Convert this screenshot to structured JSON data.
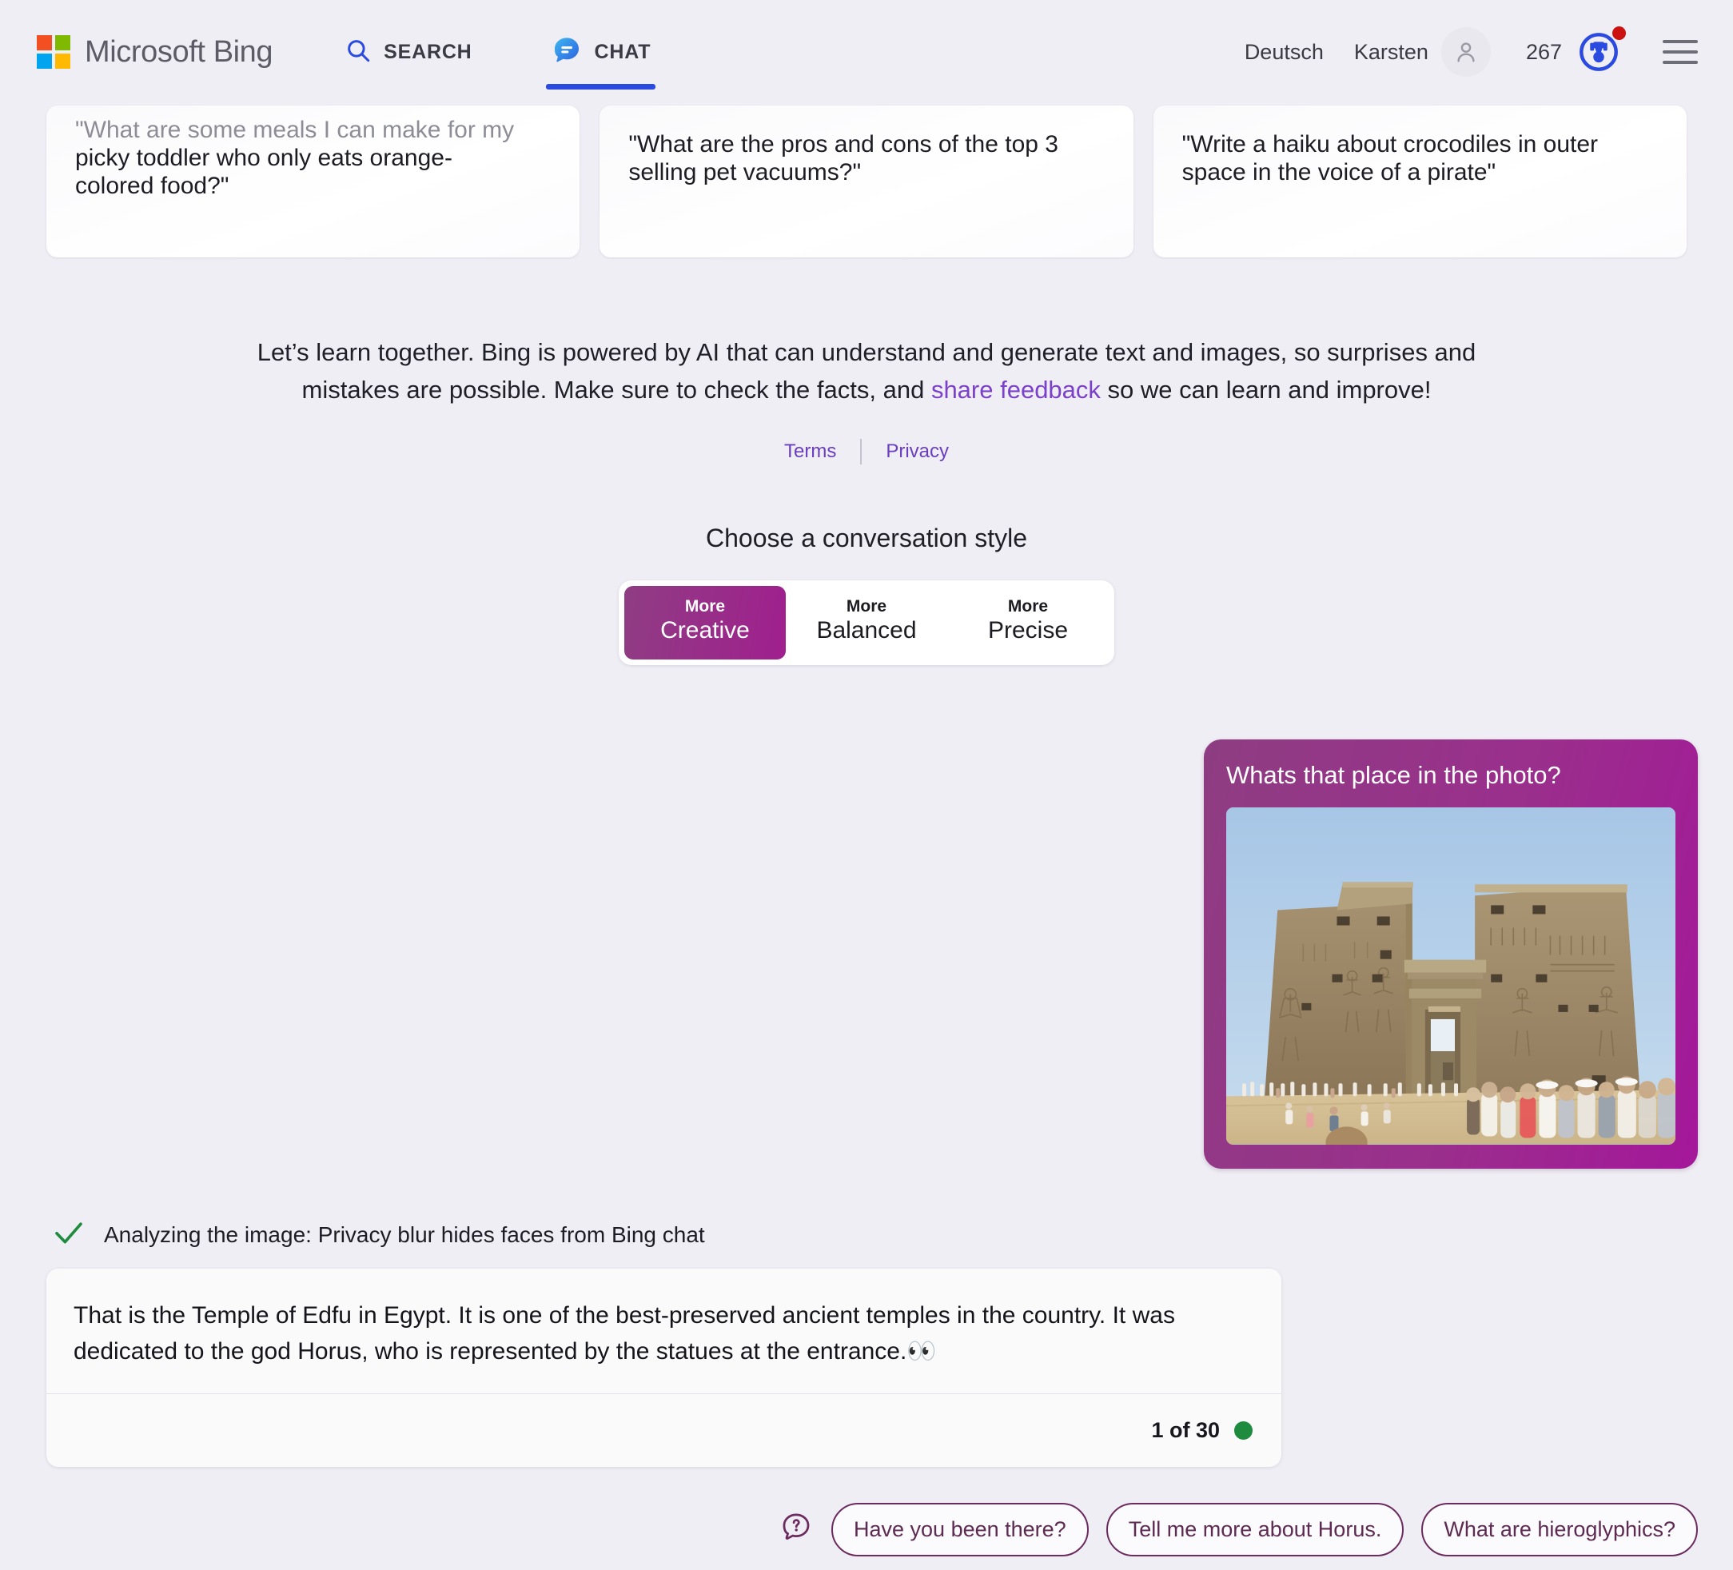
{
  "header": {
    "brand": "Microsoft Bing",
    "tabs": [
      {
        "label": "SEARCH",
        "icon": "search-icon",
        "active": false
      },
      {
        "label": "CHAT",
        "icon": "chat-bubble-icon",
        "active": true
      }
    ],
    "language": "Deutsch",
    "user_name": "Karsten",
    "rewards_count": "267",
    "account_icon": "person-icon",
    "rewards_icon": "rewards-medal-icon",
    "menu_icon": "hamburger-menu-icon",
    "accent_blue": "#2b4ae0",
    "notification_dot_color": "#cc1111"
  },
  "suggestions": [
    {
      "line1": "\"What are some meals I can make for my",
      "line2": "picky toddler who only eats orange-",
      "line3": "colored food?\""
    },
    {
      "line1": "\"What are the pros and cons of the top 3",
      "line2": "selling pet vacuums?\"",
      "line3": ""
    },
    {
      "line1": "\"Write a haiku about crocodiles in outer",
      "line2": "space in the voice of a pirate\"",
      "line3": ""
    }
  ],
  "disclaimer": {
    "part1": "Let’s learn together. Bing is powered by AI that can understand and generate text and images, so surprises and mistakes are possible. Make sure to check the facts, and ",
    "link": "share feedback",
    "part2": " so we can learn and improve!",
    "terms": "Terms",
    "privacy": "Privacy",
    "link_color": "#7b41c9"
  },
  "conversation_style": {
    "title": "Choose a conversation style",
    "options": [
      {
        "sub": "More",
        "main": "Creative",
        "selected": true
      },
      {
        "sub": "More",
        "main": "Balanced",
        "selected": false
      },
      {
        "sub": "More",
        "main": "Precise",
        "selected": false
      }
    ],
    "selected_color": "#a01f8e"
  },
  "conversation": {
    "user_message": {
      "text": "Whats that place in the photo?",
      "attachment_alt": "Photo of the Temple of Edfu pylon entrance with crowds of tourists",
      "bubble_color": "#9a2f8c"
    },
    "status": {
      "icon": "checkmark-icon",
      "text": "Analyzing the image: Privacy blur hides faces from Bing chat",
      "icon_color": "#1e8b3f"
    },
    "bot_message": {
      "text": "That is the Temple of Edfu in Egypt. It is one of the best-preserved ancient temples in the country. It was dedicated to the god Horus, who is represented by the statues at the entrance.👀",
      "turn_counter": "1 of 30",
      "turn_dot_color": "#1e8b3f"
    }
  },
  "followups": {
    "icon": "question-bubble-icon",
    "chips": [
      "Have you been there?",
      "Tell me more about Horus.",
      "What are hieroglyphics?"
    ],
    "border_color": "#6b2b5e"
  }
}
